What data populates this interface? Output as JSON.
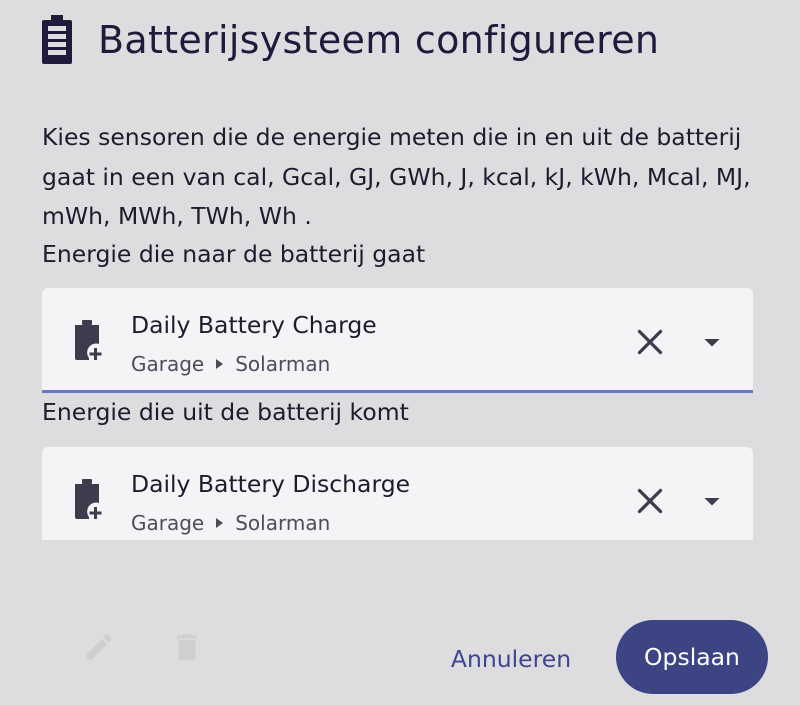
{
  "dialog": {
    "title": "Batterijsysteem configureren",
    "title_icon": "battery-icon",
    "description": "Kies sensoren die de energie meten die in en uit de batterij gaat in een van cal, Gcal, GJ, GWh, J, kcal, kJ, kWh, Mcal, MJ, mWh, MWh, TWh, Wh ."
  },
  "energy_in": {
    "label": "Energie die naar de batterij gaat",
    "entity_name": "Daily Battery Charge",
    "area": "Garage",
    "device": "Solarman",
    "icon": "battery-charging-icon"
  },
  "energy_out": {
    "label": "Energie die uit de batterij komt",
    "entity_name": "Daily Battery Discharge",
    "area": "Garage",
    "device": "Solarman",
    "icon": "battery-charging-icon"
  },
  "actions": {
    "cancel_label": "Annuleren",
    "save_label": "Opslaan"
  },
  "colors": {
    "accent": "#3d4484",
    "focus_underline": "#6a74c9",
    "background": "#dddcdf",
    "field_background": "#f4f4f6"
  }
}
